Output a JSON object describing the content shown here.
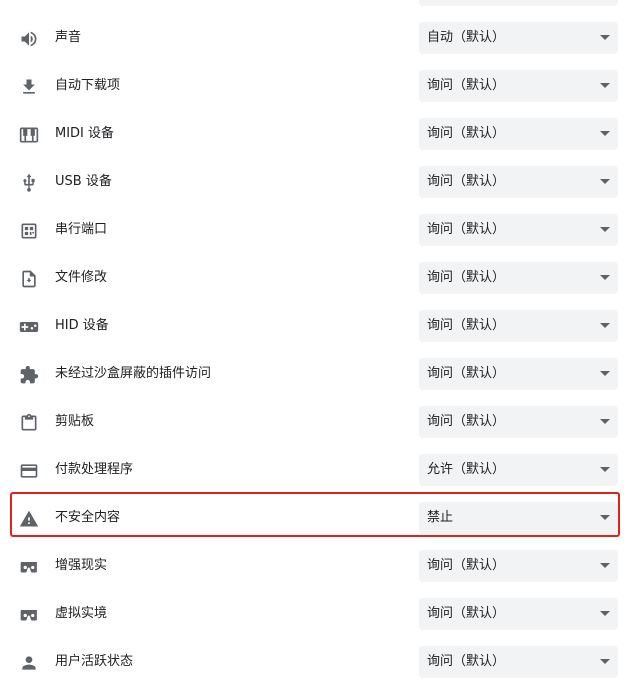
{
  "settings": [
    {
      "icon": "volume-icon",
      "label": "声音",
      "value": "自动（默认）"
    },
    {
      "icon": "download-icon",
      "label": "自动下载项",
      "value": "询问（默认）"
    },
    {
      "icon": "piano-icon",
      "label": "MIDI 设备",
      "value": "询问（默认）"
    },
    {
      "icon": "usb-icon",
      "label": "USB 设备",
      "value": "询问（默认）"
    },
    {
      "icon": "serial-port-icon",
      "label": "串行端口",
      "value": "询问（默认）"
    },
    {
      "icon": "file-edit-icon",
      "label": "文件修改",
      "value": "询问（默认）"
    },
    {
      "icon": "gamepad-icon",
      "label": "HID 设备",
      "value": "询问（默认）"
    },
    {
      "icon": "puzzle-icon",
      "label": "未经过沙盒屏蔽的插件访问",
      "value": "询问（默认）"
    },
    {
      "icon": "clipboard-icon",
      "label": "剪贴板",
      "value": "询问（默认）"
    },
    {
      "icon": "credit-card-icon",
      "label": "付款处理程序",
      "value": "允许（默认）"
    },
    {
      "icon": "warning-icon",
      "label": "不安全内容",
      "value": "禁止"
    },
    {
      "icon": "vr-headset-icon",
      "label": "增强现实",
      "value": "询问（默认）"
    },
    {
      "icon": "vr-headset-icon",
      "label": "虚拟实境",
      "value": "询问（默认）"
    },
    {
      "icon": "person-icon",
      "label": "用户活跃状态",
      "value": "询问（默认）"
    }
  ],
  "highlight_color": "#e0231b"
}
